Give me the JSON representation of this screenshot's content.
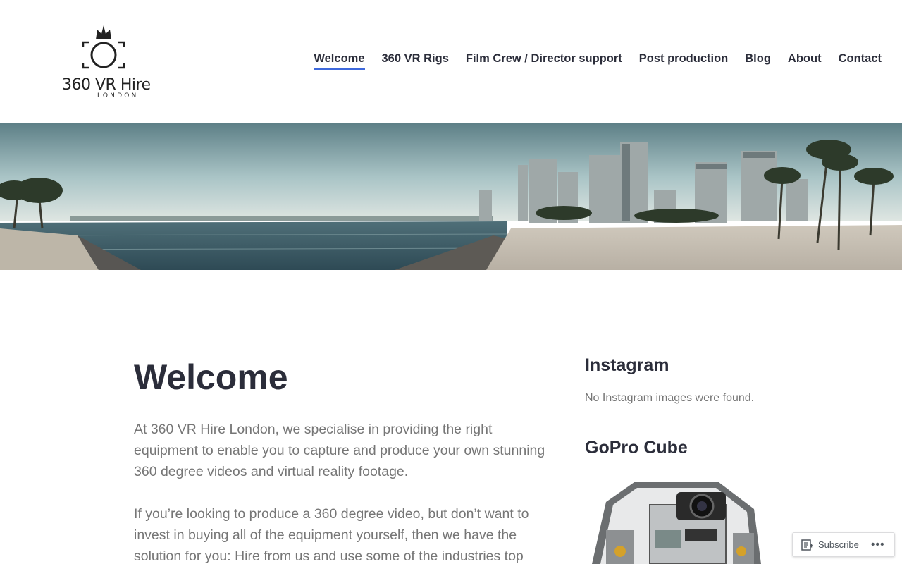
{
  "site": {
    "logo_text": "360 VR Hire",
    "logo_sub": "LONDON"
  },
  "nav": {
    "items": [
      {
        "label": "Welcome",
        "active": true
      },
      {
        "label": "360 VR Rigs",
        "active": false
      },
      {
        "label": "Film Crew / Director support",
        "active": false
      },
      {
        "label": "Post production",
        "active": false
      },
      {
        "label": "Blog",
        "active": false
      },
      {
        "label": "About",
        "active": false
      },
      {
        "label": "Contact",
        "active": false
      }
    ]
  },
  "content": {
    "title": "Welcome",
    "paragraphs": [
      "At 360 VR Hire London, we specialise in providing the right equipment to enable you to  capture and produce your own stunning 360 degree videos and virtual reality footage.",
      "If you’re looking to produce a 360 degree video, but don’t want to invest in buying all of the equipment yourself, then we have the solution for you: Hire from us and use some of the industries top"
    ]
  },
  "sidebar": {
    "instagram_title": "Instagram",
    "instagram_text": "No Instagram images were found.",
    "gopro_title": "GoPro Cube"
  },
  "subscribe": {
    "label": "Subscribe",
    "more": "•••"
  },
  "colors": {
    "accent": "#3e69dc",
    "heading": "#2b2d3a",
    "body_text": "#767676"
  }
}
